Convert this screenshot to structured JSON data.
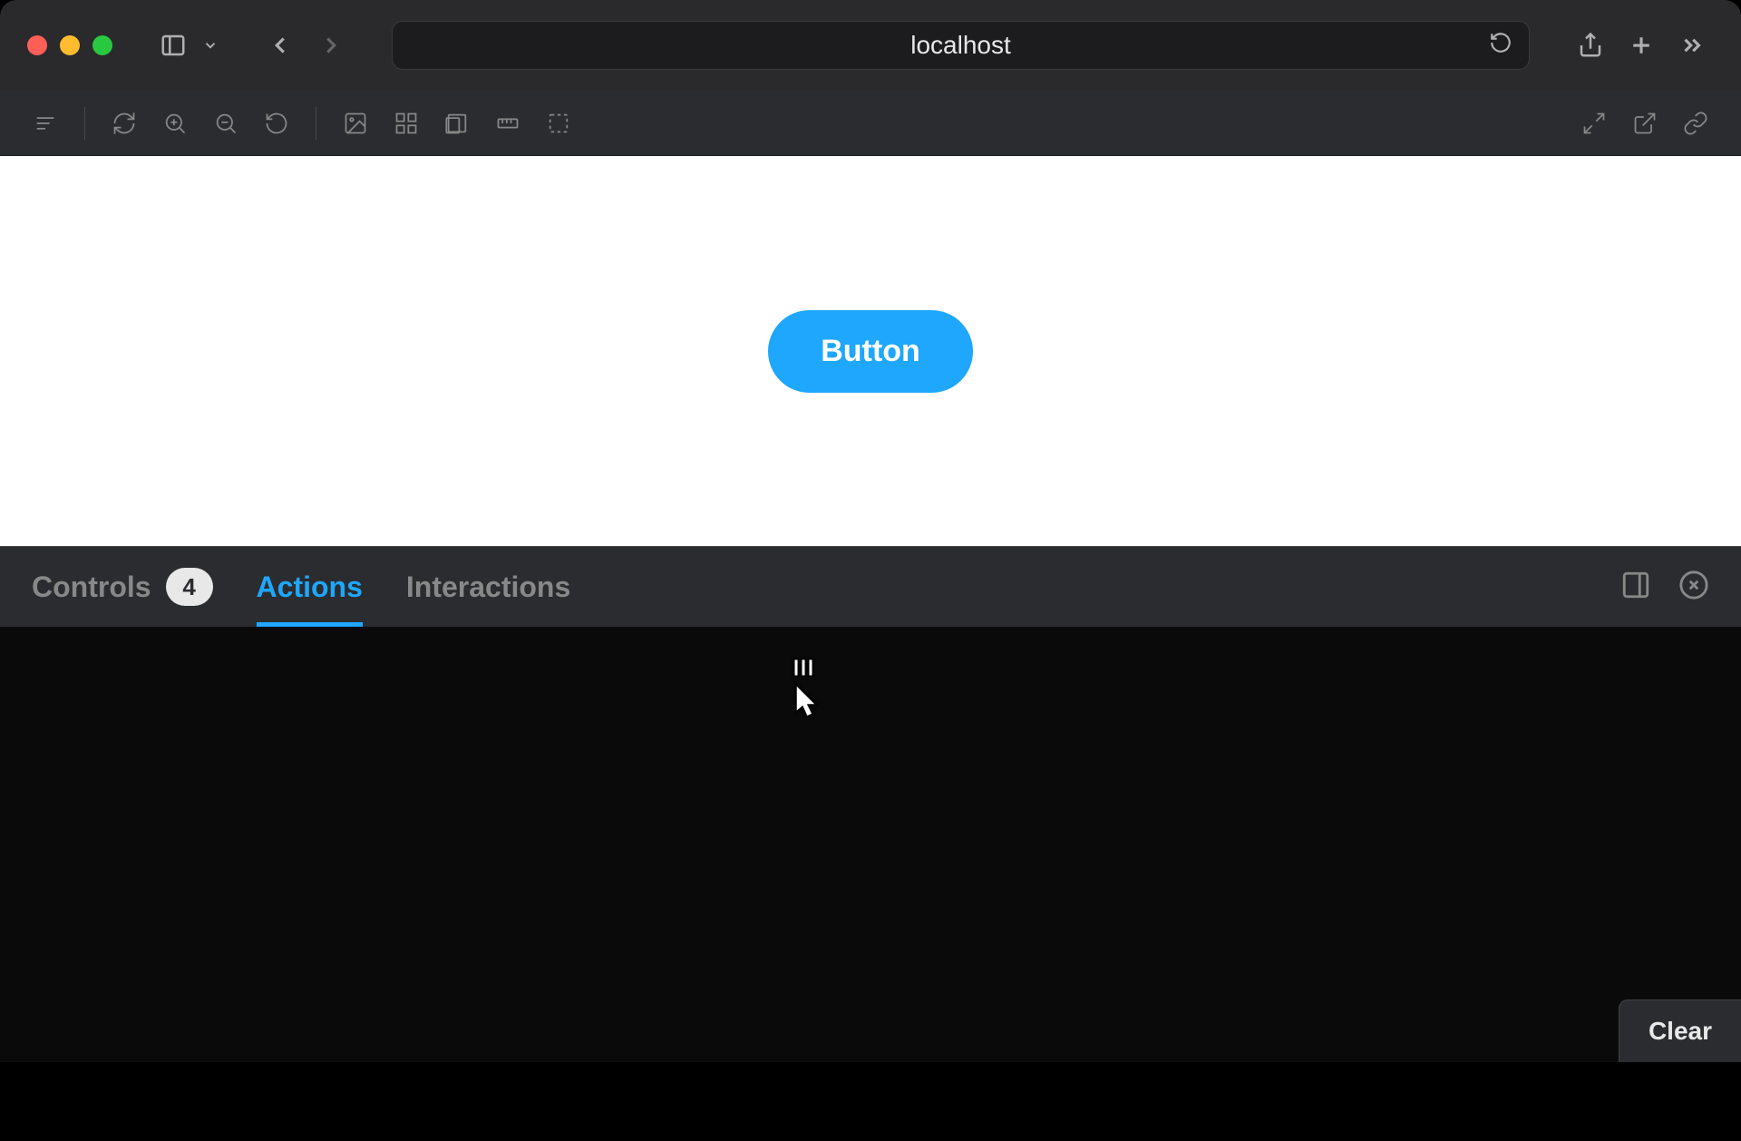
{
  "browser": {
    "address": "localhost"
  },
  "preview": {
    "button_label": "Button",
    "button_color": "#1ea7fd"
  },
  "addons": {
    "tabs": {
      "controls": {
        "label": "Controls",
        "badge": "4"
      },
      "actions": {
        "label": "Actions"
      },
      "interactions": {
        "label": "Interactions"
      }
    },
    "clear_label": "Clear"
  }
}
